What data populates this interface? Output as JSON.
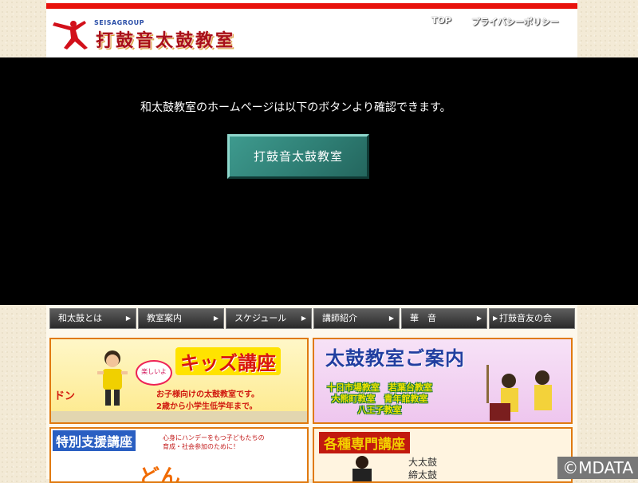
{
  "header": {
    "brand_group": "SEISAGROUP",
    "brand_title": "打鼓音太鼓教室",
    "links": [
      {
        "label": "TOP"
      },
      {
        "label": "プライバシーポリシー"
      }
    ],
    "accent_color": "#e8120c"
  },
  "overlay": {
    "message": "和太鼓教室のホームページは以下のボタンより確認できます。",
    "button_label": "打鼓音太鼓教室",
    "button_color": "#2f7f75"
  },
  "nav": {
    "items": [
      {
        "label": "和太鼓とは"
      },
      {
        "label": "教室案内"
      },
      {
        "label": "スケジュール"
      },
      {
        "label": "講師紹介"
      },
      {
        "label": "華　音"
      },
      {
        "label": "打鼓音友の会"
      }
    ],
    "arrow_glyph": "▶"
  },
  "banners": {
    "kids": {
      "title": "キッズ講座",
      "bubble": "楽しいよ",
      "don": "ドン",
      "desc_line1": "お子様向けの太鼓教室です。",
      "desc_line2": "2歳から小学生低学年まで。"
    },
    "classes": {
      "title": "太鼓教室ご案内",
      "line1": "十日市場教室　若葉台教室",
      "line2": "大熊町教室　青年館教室",
      "line3": "八王子教室"
    },
    "special": {
      "title": "特別支援講座",
      "desc_line1": "心身にハンデーをもつ子どもたちの",
      "desc_line2": "育成・社会参加のために！",
      "big": "どん"
    },
    "senmon": {
      "title": "各種専門講座",
      "line1": "大太鼓",
      "line2": "締太鼓"
    }
  },
  "copyright": "©MDATA"
}
